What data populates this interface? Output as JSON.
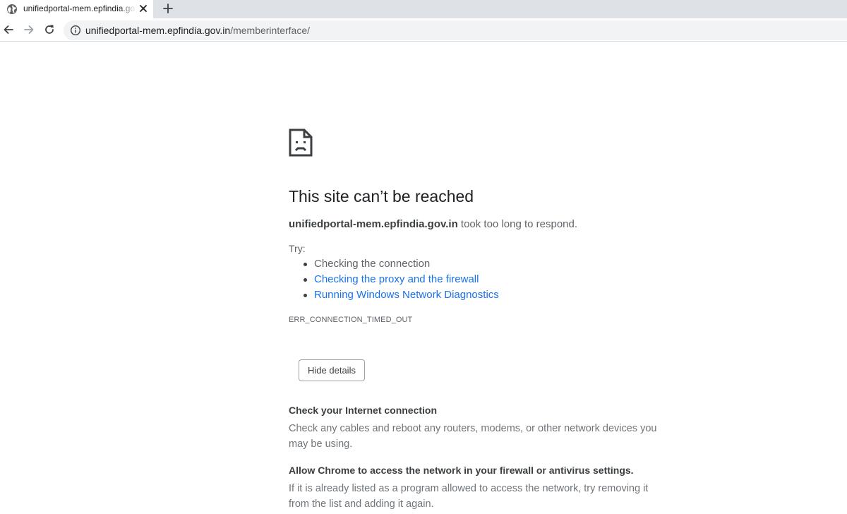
{
  "browser": {
    "tab": {
      "title": "unifiedportal-mem.epfindia.gov.in/memberinterface/",
      "favicon": "globe-icon",
      "close": "close-icon"
    },
    "new_tab": "plus-icon",
    "address": {
      "host": "unifiedportal-mem.epfindia.gov.in",
      "path": "/memberinterface/",
      "security": "info-icon"
    },
    "nav": {
      "back": "arrow-left-icon",
      "forward": "arrow-right-icon",
      "reload": "reload-icon"
    }
  },
  "error": {
    "icon": "sad-page-icon",
    "heading": "This site can’t be reached",
    "summary_host": "unifiedportal-mem.epfindia.gov.in",
    "summary_rest": " took too long to respond.",
    "try_label": "Try:",
    "suggestions": [
      "Checking the connection",
      "Checking the proxy and the firewall",
      "Running Windows Network Diagnostics"
    ],
    "code": "ERR_CONNECTION_TIMED_OUT",
    "details_button": "Hide details",
    "details": [
      {
        "title": "Check your Internet connection",
        "text": "Check any cables and reboot any routers, modems, or other network devices you may be using."
      },
      {
        "title": "Allow Chrome to access the network in your firewall or antivirus settings.",
        "text": "If it is already listed as a program allowed to access the network, try removing it from the list and adding it again."
      }
    ]
  },
  "colors": {
    "link": "#1a73e8",
    "tabstrip": "#dee1e6",
    "omnibox": "#f1f3f4",
    "text": "#5f6368"
  }
}
